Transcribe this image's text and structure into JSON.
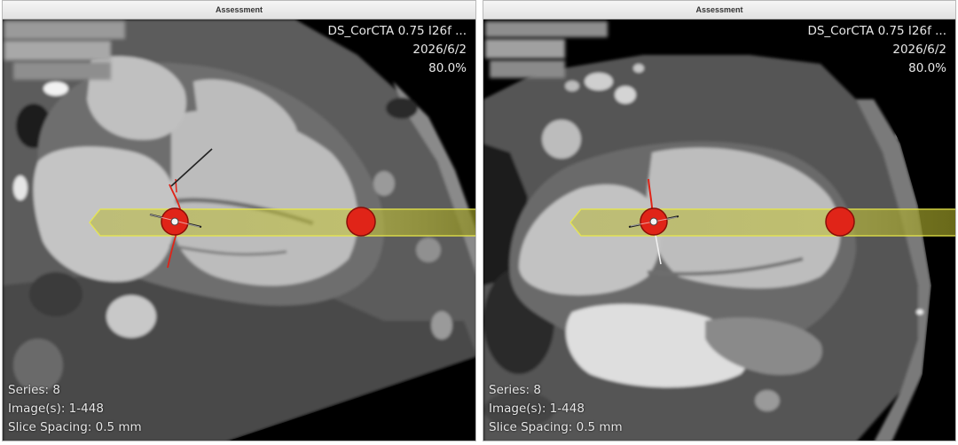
{
  "left_viewer": {
    "title": "Assessment",
    "series_desc": "DS_CorCTA  0.75  I26f  ...",
    "date": "2026/6/2",
    "zoom": "80.0%",
    "series": "Series: 8",
    "images": "Image(s): 1-448",
    "slice_spacing": "Slice Spacing: 0.5 mm"
  },
  "right_viewer": {
    "title": "Assessment",
    "series_desc": "DS_CorCTA  0.75  I26f  ...",
    "date": "2026/6/2",
    "zoom": "80.0%",
    "series": "Series: 8",
    "images": "Image(s): 1-448",
    "slice_spacing": "Slice Spacing: 0.5 mm"
  },
  "colors": {
    "band_fill": "#c8c832",
    "band_stroke": "#e8e84a",
    "marker": "#e02418",
    "background": "#000000"
  }
}
